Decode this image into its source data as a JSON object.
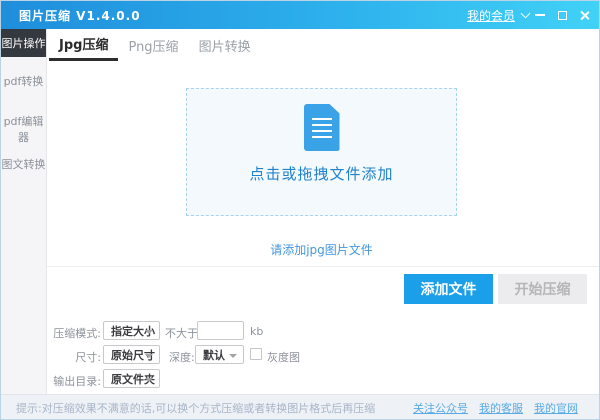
{
  "titlebar": {
    "title": "图片压缩 V1.4.0.0",
    "member_link": "我的会员"
  },
  "sidebar": {
    "header": "图片操作",
    "items": [
      {
        "label": "pdf转换"
      },
      {
        "label": "pdf编辑器"
      },
      {
        "label": "图文转换"
      }
    ]
  },
  "tabs": [
    {
      "label": "Jpg压缩",
      "active": true
    },
    {
      "label": "Png压缩",
      "active": false
    },
    {
      "label": "图片转换",
      "active": false
    }
  ],
  "dropzone": {
    "text": "点击或拖拽文件添加",
    "hint": "请添加jpg图片文件"
  },
  "buttons": {
    "add": "添加文件",
    "start": "开始压缩"
  },
  "form": {
    "mode_label": "压缩模式:",
    "mode_value": "指定大小",
    "not_greater_label": "不大于",
    "size_input_value": "",
    "unit_label": "kb",
    "dimension_label": "尺寸:",
    "dimension_value": "原始尺寸",
    "depth_label": "深度:",
    "depth_value": "默认",
    "grayscale_label": "灰度图",
    "grayscale_checked": false,
    "output_label": "输出目录:",
    "output_value": "原文件夹"
  },
  "footer": {
    "tip": "提示:对压缩效果不满意的话,可以换个方式压缩或者转换图片格式后再压缩",
    "links": [
      {
        "label": "关注公众号"
      },
      {
        "label": "我的客服"
      },
      {
        "label": "我的官网"
      }
    ]
  },
  "colors": {
    "titlebar_gradient_start": "#1f8edb",
    "titlebar_gradient_end": "#41d2f7",
    "sidebar_header_bg": "#34383f",
    "accent_blue": "#1a9fe8",
    "dropzone_bg": "#f3f9fd",
    "dropzone_border": "#a9d2ec",
    "link_blue": "#57aae3",
    "disabled_bg": "#ececee"
  }
}
